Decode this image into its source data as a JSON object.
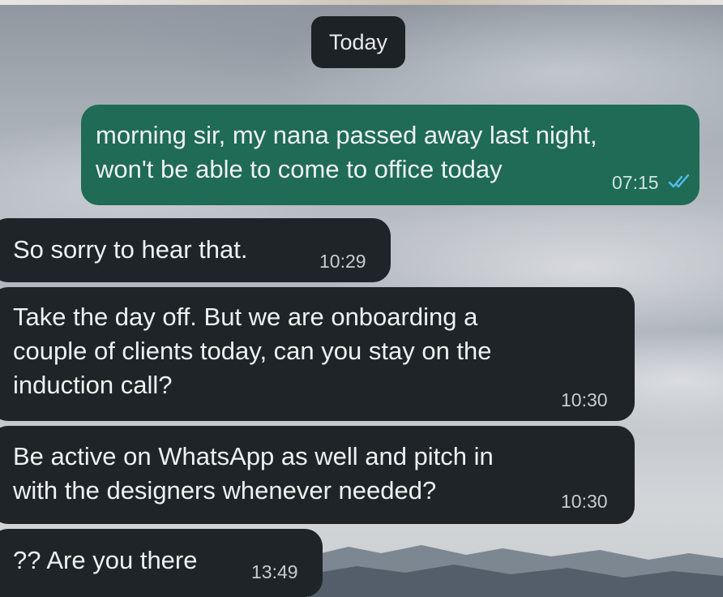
{
  "date_separator": "Today",
  "messages": [
    {
      "direction": "outgoing",
      "text": "morning sir, my nana passed away last night,\nwon't be able to come to office today",
      "time": "07:15",
      "status_icon": "double-check-read-icon"
    },
    {
      "direction": "incoming",
      "text": "So sorry to hear that.",
      "time": "10:29"
    },
    {
      "direction": "incoming",
      "text": "Take the day off. But we are onboarding a\ncouple of clients today, can you stay on the\ninduction call?",
      "time": "10:30"
    },
    {
      "direction": "incoming",
      "text": "Be active on WhatsApp as well and pitch in\nwith the designers whenever needed?",
      "time": "10:30"
    },
    {
      "direction": "incoming",
      "text": "?? Are you there",
      "time": "13:49"
    }
  ],
  "colors": {
    "incoming_bubble": "#1f2428",
    "outgoing_bubble": "#1f6b55",
    "read_ticks": "#53bdeb",
    "date_chip": "#1d2226"
  }
}
